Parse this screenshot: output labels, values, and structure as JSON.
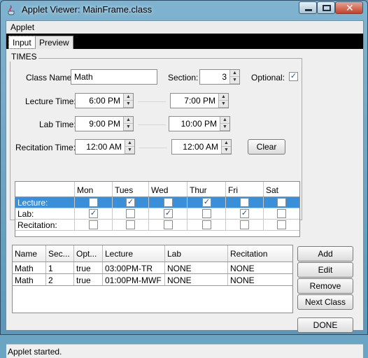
{
  "window": {
    "title": "Applet Viewer: MainFrame.class"
  },
  "menu": {
    "applet": "Applet"
  },
  "tabs": [
    {
      "label": "Input",
      "active": true
    },
    {
      "label": "Preview",
      "active": false
    }
  ],
  "times": {
    "group_title": "TIMES",
    "class_name_label": "Class Name:",
    "class_name_value": "Math",
    "section_label": "Section:",
    "section_value": "3",
    "optional_label": "Optional:",
    "optional_checked": true,
    "lecture_label": "Lecture Time:",
    "lecture_start": "6:00 PM",
    "lecture_end": "7:00 PM",
    "lab_label": "Lab Time:",
    "lab_start": "9:00 PM",
    "lab_end": "10:00 PM",
    "recitation_label": "Recitation Time:",
    "recitation_start": "12:00 AM",
    "recitation_end": "12:00 AM",
    "clear_button": "Clear"
  },
  "schedule": {
    "days": [
      "Mon",
      "Tues",
      "Wed",
      "Thur",
      "Fri",
      "Sat"
    ],
    "rows": [
      {
        "label": "Lecture:",
        "selected": true,
        "checks": [
          false,
          true,
          false,
          true,
          false,
          false
        ]
      },
      {
        "label": "Lab:",
        "selected": false,
        "checks": [
          true,
          false,
          true,
          false,
          true,
          false
        ]
      },
      {
        "label": "Recitation:",
        "selected": false,
        "checks": [
          false,
          false,
          false,
          false,
          false,
          false
        ]
      }
    ]
  },
  "classes_table": {
    "columns": [
      "Name",
      "Sec...",
      "Opt...",
      "Lecture",
      "Lab",
      "Recitation"
    ],
    "rows": [
      [
        "Math",
        "1",
        "true",
        "03:00PM-TR",
        "NONE",
        "NONE"
      ],
      [
        "Math",
        "2",
        "true",
        "01:00PM-MWF",
        "NONE",
        "NONE"
      ]
    ]
  },
  "actions": {
    "add": "Add",
    "edit": "Edit",
    "remove": "Remove",
    "next_class": "Next Class",
    "done": "DONE"
  },
  "status": {
    "text": "Applet started."
  },
  "colors": {
    "selection": "#3b8fd9",
    "titlebar": "#6aa5c4",
    "panel": "#efefef"
  }
}
